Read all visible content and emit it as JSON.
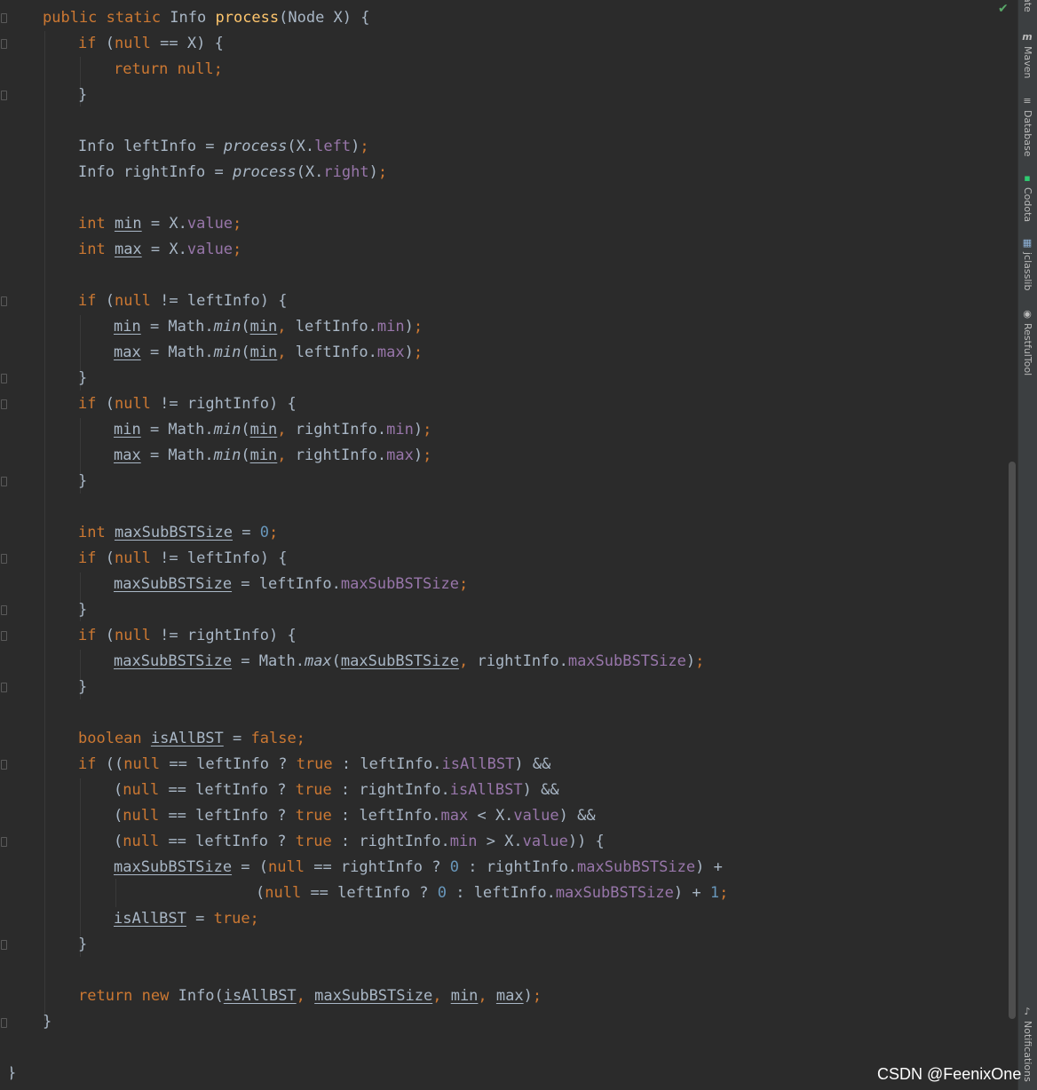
{
  "editor": {
    "lines": [
      [
        {
          "t": "public static ",
          "c": "kw"
        },
        {
          "t": "Info "
        },
        {
          "t": "process",
          "c": "fn"
        },
        {
          "t": "(Node X) {"
        }
      ],
      [
        {
          "t": "if ",
          "c": "kw"
        },
        {
          "t": "("
        },
        {
          "t": "null ",
          "c": "kw"
        },
        {
          "t": "== X) {"
        }
      ],
      [
        {
          "t": "return null;",
          "c": "kw"
        }
      ],
      [
        {
          "t": "}"
        }
      ],
      [],
      [
        {
          "t": "Info leftInfo = "
        },
        {
          "t": "process",
          "c": "it"
        },
        {
          "t": "(X."
        },
        {
          "t": "left",
          "c": "fd"
        },
        {
          "t": ")"
        },
        {
          "t": ";",
          "c": "kw"
        }
      ],
      [
        {
          "t": "Info rightInfo = "
        },
        {
          "t": "process",
          "c": "it"
        },
        {
          "t": "(X."
        },
        {
          "t": "right",
          "c": "fd"
        },
        {
          "t": ")"
        },
        {
          "t": ";",
          "c": "kw"
        }
      ],
      [],
      [
        {
          "t": "int ",
          "c": "kw"
        },
        {
          "t": "min",
          "c": "var"
        },
        {
          "t": " = X."
        },
        {
          "t": "value",
          "c": "fd"
        },
        {
          "t": ";",
          "c": "kw"
        }
      ],
      [
        {
          "t": "int ",
          "c": "kw"
        },
        {
          "t": "max",
          "c": "var"
        },
        {
          "t": " = X."
        },
        {
          "t": "value",
          "c": "fd"
        },
        {
          "t": ";",
          "c": "kw"
        }
      ],
      [],
      [
        {
          "t": "if ",
          "c": "kw"
        },
        {
          "t": "("
        },
        {
          "t": "null ",
          "c": "kw"
        },
        {
          "t": "!= leftInfo) {"
        }
      ],
      [
        {
          "t": "min",
          "c": "var"
        },
        {
          "t": " = Math."
        },
        {
          "t": "min",
          "c": "it"
        },
        {
          "t": "("
        },
        {
          "t": "min",
          "c": "var"
        },
        {
          "t": ", ",
          "c": "kw"
        },
        {
          "t": "leftInfo."
        },
        {
          "t": "min",
          "c": "fd"
        },
        {
          "t": ")"
        },
        {
          "t": ";",
          "c": "kw"
        }
      ],
      [
        {
          "t": "max",
          "c": "var"
        },
        {
          "t": " = Math."
        },
        {
          "t": "min",
          "c": "it"
        },
        {
          "t": "("
        },
        {
          "t": "min",
          "c": "var"
        },
        {
          "t": ", ",
          "c": "kw"
        },
        {
          "t": "leftInfo."
        },
        {
          "t": "max",
          "c": "fd"
        },
        {
          "t": ")"
        },
        {
          "t": ";",
          "c": "kw"
        }
      ],
      [
        {
          "t": "}"
        }
      ],
      [
        {
          "t": "if ",
          "c": "kw"
        },
        {
          "t": "("
        },
        {
          "t": "null ",
          "c": "kw"
        },
        {
          "t": "!= rightInfo) {"
        }
      ],
      [
        {
          "t": "min",
          "c": "var"
        },
        {
          "t": " = Math."
        },
        {
          "t": "min",
          "c": "it"
        },
        {
          "t": "("
        },
        {
          "t": "min",
          "c": "var"
        },
        {
          "t": ", ",
          "c": "kw"
        },
        {
          "t": "rightInfo."
        },
        {
          "t": "min",
          "c": "fd"
        },
        {
          "t": ")"
        },
        {
          "t": ";",
          "c": "kw"
        }
      ],
      [
        {
          "t": "max",
          "c": "var"
        },
        {
          "t": " = Math."
        },
        {
          "t": "min",
          "c": "it"
        },
        {
          "t": "("
        },
        {
          "t": "min",
          "c": "var"
        },
        {
          "t": ", ",
          "c": "kw"
        },
        {
          "t": "rightInfo."
        },
        {
          "t": "max",
          "c": "fd"
        },
        {
          "t": ")"
        },
        {
          "t": ";",
          "c": "kw"
        }
      ],
      [
        {
          "t": "}"
        }
      ],
      [],
      [
        {
          "t": "int ",
          "c": "kw"
        },
        {
          "t": "maxSubBSTSize",
          "c": "var"
        },
        {
          "t": " = "
        },
        {
          "t": "0",
          "c": "num"
        },
        {
          "t": ";",
          "c": "kw"
        }
      ],
      [
        {
          "t": "if ",
          "c": "kw"
        },
        {
          "t": "("
        },
        {
          "t": "null ",
          "c": "kw"
        },
        {
          "t": "!= leftInfo) {"
        }
      ],
      [
        {
          "t": "maxSubBSTSize",
          "c": "var"
        },
        {
          "t": " = leftInfo."
        },
        {
          "t": "maxSubBSTSize",
          "c": "fd"
        },
        {
          "t": ";",
          "c": "kw"
        }
      ],
      [
        {
          "t": "}"
        }
      ],
      [
        {
          "t": "if ",
          "c": "kw"
        },
        {
          "t": "("
        },
        {
          "t": "null ",
          "c": "kw"
        },
        {
          "t": "!= rightInfo) {"
        }
      ],
      [
        {
          "t": "maxSubBSTSize",
          "c": "var"
        },
        {
          "t": " = Math."
        },
        {
          "t": "max",
          "c": "it"
        },
        {
          "t": "("
        },
        {
          "t": "maxSubBSTSize",
          "c": "var"
        },
        {
          "t": ", ",
          "c": "kw"
        },
        {
          "t": "rightInfo."
        },
        {
          "t": "maxSubBSTSize",
          "c": "fd"
        },
        {
          "t": ")"
        },
        {
          "t": ";",
          "c": "kw"
        }
      ],
      [
        {
          "t": "}"
        }
      ],
      [],
      [
        {
          "t": "boolean ",
          "c": "kw"
        },
        {
          "t": "isAllBST",
          "c": "var"
        },
        {
          "t": " = "
        },
        {
          "t": "false;",
          "c": "kw"
        }
      ],
      [
        {
          "t": "if ",
          "c": "kw"
        },
        {
          "t": "(("
        },
        {
          "t": "null ",
          "c": "kw"
        },
        {
          "t": "== leftInfo ? "
        },
        {
          "t": "true ",
          "c": "kw"
        },
        {
          "t": ": leftInfo."
        },
        {
          "t": "isAllBST",
          "c": "fd"
        },
        {
          "t": ") &&"
        }
      ],
      [
        {
          "t": "("
        },
        {
          "t": "null ",
          "c": "kw"
        },
        {
          "t": "== leftInfo ? "
        },
        {
          "t": "true ",
          "c": "kw"
        },
        {
          "t": ": rightInfo."
        },
        {
          "t": "isAllBST",
          "c": "fd"
        },
        {
          "t": ") &&"
        }
      ],
      [
        {
          "t": "("
        },
        {
          "t": "null ",
          "c": "kw"
        },
        {
          "t": "== leftInfo ? "
        },
        {
          "t": "true ",
          "c": "kw"
        },
        {
          "t": ": leftInfo."
        },
        {
          "t": "max",
          "c": "fd"
        },
        {
          "t": " < X."
        },
        {
          "t": "value",
          "c": "fd"
        },
        {
          "t": ") &&"
        }
      ],
      [
        {
          "t": "("
        },
        {
          "t": "null ",
          "c": "kw"
        },
        {
          "t": "== leftInfo ? "
        },
        {
          "t": "true ",
          "c": "kw"
        },
        {
          "t": ": rightInfo."
        },
        {
          "t": "min",
          "c": "fd"
        },
        {
          "t": " > X."
        },
        {
          "t": "value",
          "c": "fd"
        },
        {
          "t": ")) {"
        }
      ],
      [
        {
          "t": "maxSubBSTSize",
          "c": "var"
        },
        {
          "t": " = ("
        },
        {
          "t": "null ",
          "c": "kw"
        },
        {
          "t": "== rightInfo ? "
        },
        {
          "t": "0",
          "c": "num"
        },
        {
          "t": " : rightInfo."
        },
        {
          "t": "maxSubBSTSize",
          "c": "fd"
        },
        {
          "t": ") +"
        }
      ],
      [
        {
          "t": "("
        },
        {
          "t": "null ",
          "c": "kw"
        },
        {
          "t": "== leftInfo ? "
        },
        {
          "t": "0",
          "c": "num"
        },
        {
          "t": " : leftInfo."
        },
        {
          "t": "maxSubBSTSize",
          "c": "fd"
        },
        {
          "t": ") + "
        },
        {
          "t": "1",
          "c": "num"
        },
        {
          "t": ";",
          "c": "kw"
        }
      ],
      [
        {
          "t": "isAllBST",
          "c": "var"
        },
        {
          "t": " = "
        },
        {
          "t": "true;",
          "c": "kw"
        }
      ],
      [
        {
          "t": "}"
        }
      ],
      [],
      [
        {
          "t": "return new ",
          "c": "kw"
        },
        {
          "t": "Info("
        },
        {
          "t": "isAllBST",
          "c": "var"
        },
        {
          "t": ", ",
          "c": "kw"
        },
        {
          "t": "maxSubBSTSize",
          "c": "var"
        },
        {
          "t": ", ",
          "c": "kw"
        },
        {
          "t": "min",
          "c": "var"
        },
        {
          "t": ", ",
          "c": "kw"
        },
        {
          "t": "max",
          "c": "var"
        },
        {
          "t": ")"
        },
        {
          "t": ";",
          "c": "kw"
        }
      ],
      [
        {
          "t": "}"
        }
      ],
      [],
      [
        {
          "t": "}"
        }
      ]
    ]
  },
  "tool_window_strip": [
    {
      "label": "ate",
      "icon": "partial-tab-icon"
    },
    {
      "label": "Maven",
      "icon": "maven-icon",
      "glyph": "m"
    },
    {
      "label": "Database",
      "icon": "database-icon",
      "glyph": "≡"
    },
    {
      "label": "Codota",
      "icon": "codota-icon",
      "glyph": "▪"
    },
    {
      "label": "jclasslib",
      "icon": "jclasslib-icon",
      "glyph": "▦"
    },
    {
      "label": "RestfulTool",
      "icon": "restfultool-icon",
      "glyph": "◉"
    },
    {
      "label": "Notifications",
      "icon": "notifications-bell-icon",
      "glyph": "♪"
    }
  ],
  "inspection_status": {
    "icon": "checkmark-icon",
    "glyph": "✔"
  },
  "watermark": "CSDN @FeenixOne",
  "colors": {
    "background": "#2b2b2b",
    "keyword": "#cc7832",
    "method_decl": "#ffc66d",
    "field": "#9876aa",
    "number": "#6897bb",
    "default_text": "#a9b7c6",
    "tool_strip": "#3c3f41"
  }
}
